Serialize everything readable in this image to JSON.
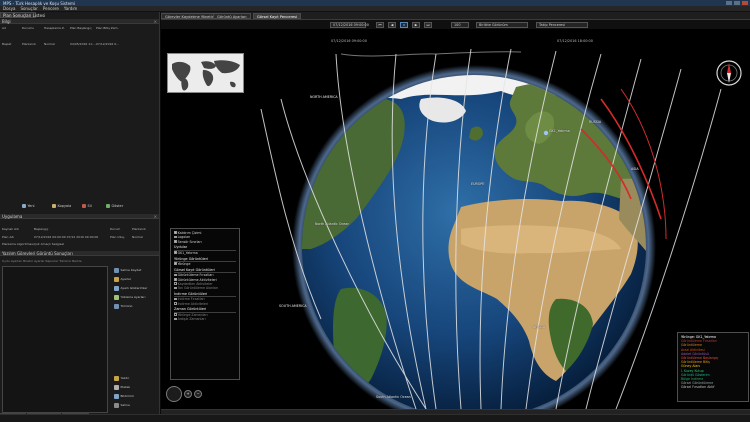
{
  "window": {
    "title": "MPS - Türk Hesaplık ve Koşu Sistemi"
  },
  "menu": [
    "Dosya",
    "Sonuçlar",
    "Pencere",
    "Yardım"
  ],
  "left_panel": {
    "top_tab": "Plan Sonuçları Listesi",
    "section": "Bilgi",
    "columns": [
      "Ad",
      "Durumu",
      "Hesaplama Z.",
      "Plan Başlangıç",
      "Plan Bitiş Zam."
    ],
    "row_values": [
      "Başlat",
      "Planlandı",
      "Normal",
      "04/05/2016 11:...",
      "07/12/2016 0..."
    ],
    "toolbar": [
      "Yeni",
      "Kopyala",
      "Sil",
      "Göster"
    ],
    "section2": "Uygulama",
    "columns2": [
      "Kaynak Adı",
      "Başlangıç",
      "Durum",
      "Planlandı"
    ],
    "row2_values": [
      "Plan Adı",
      "07/12/2016 09:00:00 07/12 2016 09:00:00",
      "Plan Oluş.",
      "Normal"
    ],
    "row3_values": [
      "Planlama Algoritması",
      "Çok Amaçlı Sezgisel"
    ],
    "section3": "Yazılım Görevleri Görüntü Sonuçları",
    "filter_text": "Uydu Ayarları  Birebir Ayarlar  Raporlar  Tümünü  Belirle",
    "side_buttons": [
      "Sahne Kaydet",
      "Ayarlar",
      "Ayarlı Gösterimler",
      "Yükleme Ayarları",
      "Tümünü"
    ],
    "side_buttons2": [
      "Yazdır",
      "Plakalı",
      "Bildirimli",
      "Sahne"
    ],
    "bottom_tabs": [
      "Görev Takibi",
      "Bildirim Penceresi",
      "Görev Listesi"
    ]
  },
  "view_tabs": [
    "Görevler Kaydetme Yönetimi",
    "Görüntü Ayarları",
    "Görsel Kayıt Penceresi"
  ],
  "controls": {
    "time": "07/12/2016 09:00:00",
    "play_buttons": [
      "⏮",
      "◀",
      "⏸",
      "▶",
      "⏭"
    ],
    "speed": "100",
    "mode1": "Birlikte Görünüm",
    "mode2": "Takip Penceresi",
    "time_start": "07/12/2016 09:00:00",
    "time_end": "07/12/2016 18:00:00"
  },
  "layers": {
    "items_top": [
      {
        "label": "Kaldırım Çizimi",
        "on": true
      },
      {
        "label": "Logoları",
        "on": true
      },
      {
        "label": "Sensör Sınırları",
        "on": true
      }
    ],
    "section_uydular": "Uydular",
    "uydu_items": [
      {
        "label": "GK1_Yatırma",
        "on": true
      }
    ],
    "section_yorunge": "Yörünge Görüntüleri",
    "yorunge_items": [
      {
        "label": "Yörünge",
        "on": true
      }
    ],
    "section_kaynak": "Görsel Kayıt Görüntüleri",
    "kaynak_items": [
      {
        "label": "Görüntüleme Fırsatları",
        "on": true
      },
      {
        "label": "Görüntüleme Aktiviteleri",
        "on": true
      },
      {
        "label": "Kaydedilen Aktiviteler",
        "on": false
      },
      {
        "label": "Ton Görüntüleme Alanları",
        "on": false
      }
    ],
    "section_indirme": "İndirme Görüntüleri",
    "indirme_items": [
      {
        "label": "İndirme Fırsatları",
        "on": false
      },
      {
        "label": "İndirme Aktiviteleri",
        "on": false
      }
    ],
    "section_zaman": "Zaman Görüntüleri",
    "zaman_items": [
      {
        "label": "Yörünge Zamanları",
        "on": false
      },
      {
        "label": "Ardışık Zamanları",
        "on": false
      }
    ]
  },
  "legend": {
    "items": [
      {
        "label": "Yörünge: GK1_Yatırma",
        "color": "#ffffff"
      },
      {
        "label": "Görüntüleme Fırsatları",
        "color": "#c0392b"
      },
      {
        "label": "Görüntüleme",
        "color": "#e67e22"
      },
      {
        "label": "Arazi Aktivitesi",
        "color": "#d35400"
      },
      {
        "label": "Adalet Görüntüsü",
        "color": "#9b59b6"
      },
      {
        "label": "Görüntüleme Başlangıç",
        "color": "#e74c3c"
      },
      {
        "label": "Görüntüleme Bitiş",
        "color": "#f39c12"
      },
      {
        "label": "Güney Alanı",
        "color": "#f1c40f"
      },
      {
        "label": "İ. Kuzey Kutup",
        "color": "#2ecc71"
      },
      {
        "label": "Görüntü Gösterim",
        "color": "#1abc9c"
      },
      {
        "label": "Bölge İndirme",
        "color": "#27ae60"
      },
      {
        "label": "Görsel Görüntüleme",
        "color": "#95a5a6"
      },
      {
        "label": "Görsel Fırsatları Aktif",
        "color": "#bdc3c7"
      }
    ]
  },
  "geo_labels": {
    "north_atlantic": "North Atlantic Ocean",
    "south_atlantic": "South Atlantic Ocean",
    "europe": "EUROPE",
    "africa": "AFRICA",
    "russia": "RUSSIA",
    "sat": "GK1_Yatırma",
    "north_america": "NORTH AMERICA",
    "south_america": "SOUTH AMERICA",
    "asia": "ASIA"
  },
  "colors": {
    "accent": "#5b86b8",
    "orbit": "#e6e6e6",
    "imaging": "#d22b2b"
  }
}
